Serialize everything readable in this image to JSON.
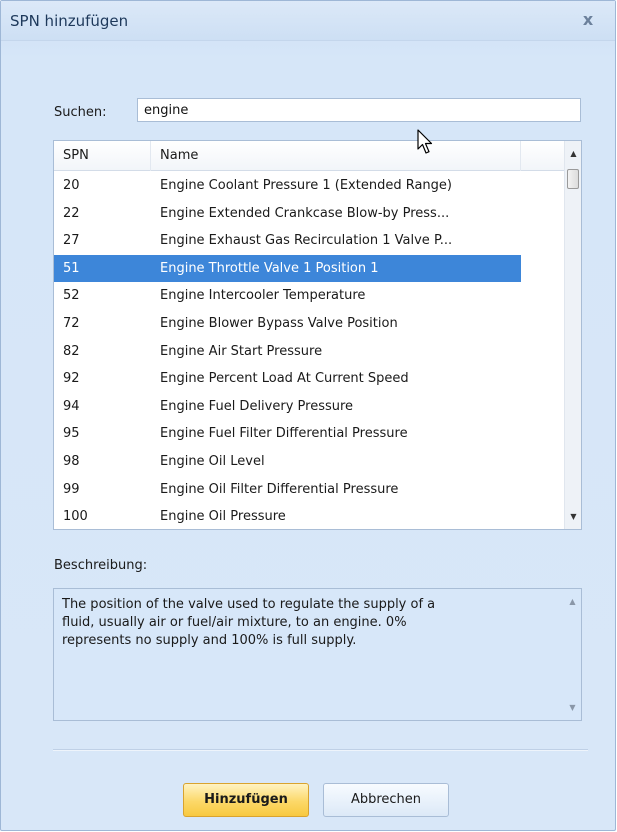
{
  "dialog": {
    "title": "SPN hinzufügen",
    "close_label": "x"
  },
  "search": {
    "label": "Suchen:",
    "value": "engine"
  },
  "list": {
    "columns": {
      "spn": "SPN",
      "name": "Name"
    },
    "selected_index": 3,
    "rows": [
      {
        "spn": "20",
        "name": "Engine Coolant Pressure 1 (Extended Range)"
      },
      {
        "spn": "22",
        "name": "Engine Extended Crankcase Blow-by Press..."
      },
      {
        "spn": "27",
        "name": "Engine Exhaust Gas Recirculation 1 Valve P..."
      },
      {
        "spn": "51",
        "name": "Engine Throttle Valve 1 Position 1"
      },
      {
        "spn": "52",
        "name": "Engine Intercooler Temperature"
      },
      {
        "spn": "72",
        "name": "Engine Blower Bypass Valve Position"
      },
      {
        "spn": "82",
        "name": "Engine Air Start Pressure"
      },
      {
        "spn": "92",
        "name": "Engine Percent Load At Current Speed"
      },
      {
        "spn": "94",
        "name": "Engine Fuel Delivery Pressure"
      },
      {
        "spn": "95",
        "name": "Engine Fuel Filter Differential Pressure"
      },
      {
        "spn": "98",
        "name": "Engine Oil Level"
      },
      {
        "spn": "99",
        "name": "Engine Oil Filter Differential Pressure"
      },
      {
        "spn": "100",
        "name": "Engine Oil Pressure"
      }
    ]
  },
  "description": {
    "label": "Beschreibung:",
    "text": "The position of the valve used to regulate the supply of a\nfluid, usually air or fuel/air mixture, to an engine.  0%\nrepresents no supply and 100% is full supply."
  },
  "buttons": {
    "add_label": "Hinzufügen",
    "cancel_label": "Abbrechen"
  },
  "colors": {
    "selection": "#3d86d9",
    "window_bg": "#d8e7f8",
    "add_button": "#fcd868"
  },
  "icons": {
    "close": "close-icon",
    "scroll_up": "chevron-up-icon",
    "scroll_down": "chevron-down-icon",
    "cursor": "mouse-pointer-icon"
  }
}
